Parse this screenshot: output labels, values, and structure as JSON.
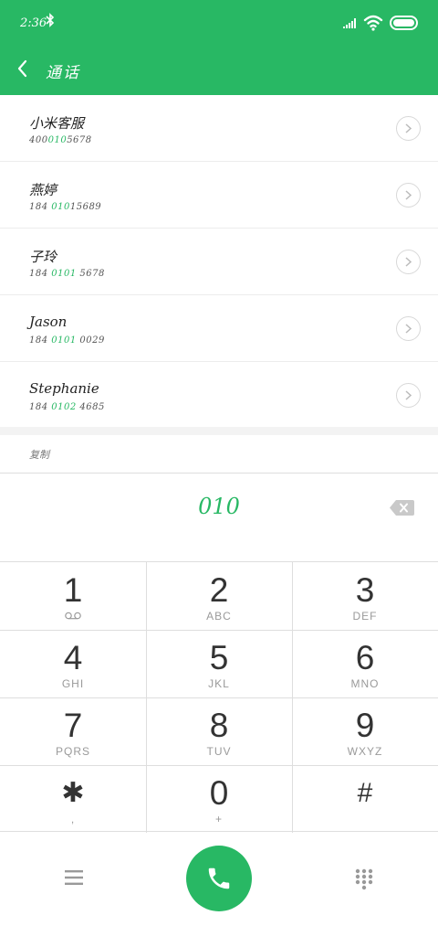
{
  "status_bar": {
    "time": "2:36",
    "bluetooth": "bluetooth-icon",
    "signal": "signal-icon",
    "wifi": "wifi-icon",
    "battery": "battery-icon"
  },
  "header": {
    "title": "通话",
    "back": "back-arrow-icon",
    "color": "#28b864"
  },
  "contacts": [
    {
      "name": "小米客服",
      "number_pre": "400",
      "number_match": "010",
      "number_post": "5678"
    },
    {
      "name": "燕婷",
      "number_pre": "184 ",
      "number_match": "010",
      "number_post": "15689"
    },
    {
      "name": "子玲",
      "number_pre": "184 ",
      "number_match": "0101",
      "number_post": " 5678"
    },
    {
      "name": "Jason",
      "number_pre": "184 ",
      "number_match": "0101",
      "number_post": " 0029"
    },
    {
      "name": "Stephanie",
      "number_pre": "184 ",
      "number_match": "0102",
      "number_post": " 4685"
    }
  ],
  "copy_label": "复制",
  "dialed_number": "010",
  "keypad": [
    {
      "digit": "1",
      "sub": "voicemail-icon"
    },
    {
      "digit": "2",
      "sub": "ABC"
    },
    {
      "digit": "3",
      "sub": "DEF"
    },
    {
      "digit": "4",
      "sub": "GHI"
    },
    {
      "digit": "5",
      "sub": "JKL"
    },
    {
      "digit": "6",
      "sub": "MNO"
    },
    {
      "digit": "7",
      "sub": "PQRS"
    },
    {
      "digit": "8",
      "sub": "TUV"
    },
    {
      "digit": "9",
      "sub": "WXYZ"
    },
    {
      "digit": "*",
      "sub": ",",
      "digit_glyph": "✱"
    },
    {
      "digit": "0",
      "sub": "+"
    },
    {
      "digit": "#",
      "sub": ""
    }
  ],
  "bottom_bar": {
    "menu": "menu-icon",
    "call": "phone-icon",
    "dialpad": "dialpad-icon"
  }
}
